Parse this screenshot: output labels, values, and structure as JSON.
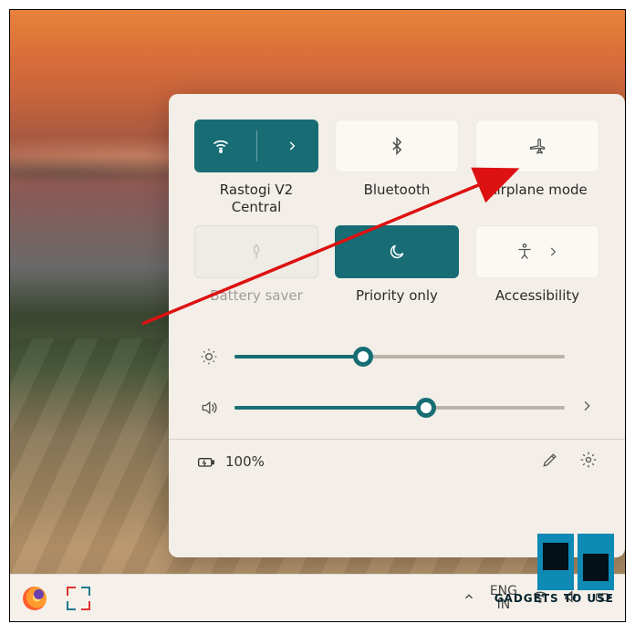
{
  "colors": {
    "accent": "#186d75"
  },
  "tiles": {
    "wifi": {
      "label": "Rastogi V2 Central",
      "active": true,
      "expandable": true
    },
    "bluetooth": {
      "label": "Bluetooth",
      "active": false
    },
    "airplane": {
      "label": "Airplane mode",
      "active": false
    },
    "battery": {
      "label": "Battery saver",
      "disabled": true
    },
    "focus": {
      "label": "Priority only",
      "active": true
    },
    "accessibility": {
      "label": "Accessibility",
      "active": false,
      "expandable": true
    }
  },
  "sliders": {
    "brightness": {
      "value": 39,
      "min": 0,
      "max": 100
    },
    "volume": {
      "value": 58,
      "min": 0,
      "max": 100,
      "expandable": true
    }
  },
  "footer": {
    "battery_text": "100%"
  },
  "taskbar": {
    "language_line1": "ENG",
    "language_line2": "IN"
  },
  "watermark": {
    "text": "GADGETS TO USE"
  }
}
